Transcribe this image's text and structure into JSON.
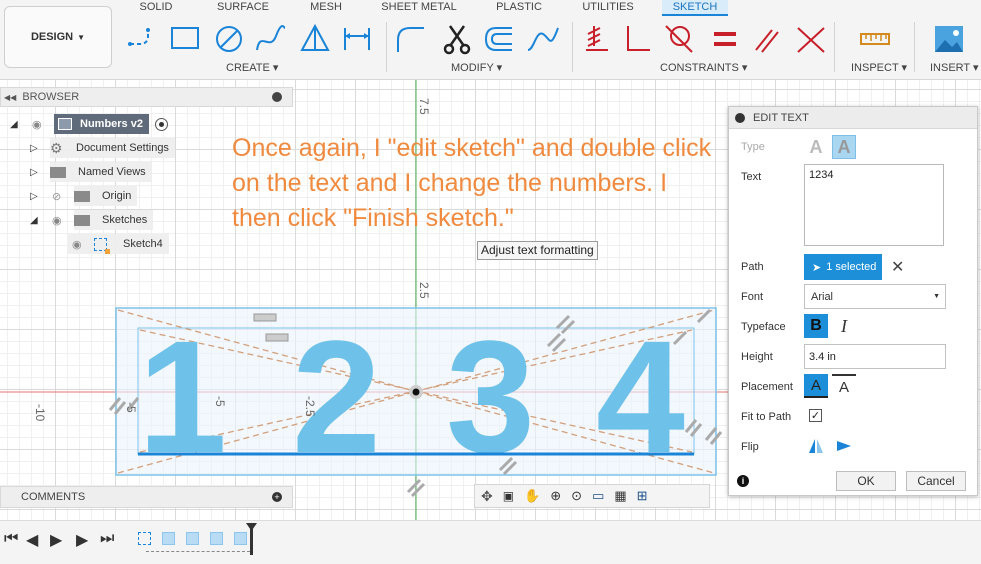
{
  "toolbar": {
    "design_label": "DESIGN",
    "tabs": [
      "SOLID",
      "SURFACE",
      "MESH",
      "SHEET METAL",
      "PLASTIC",
      "UTILITIES",
      "SKETCH"
    ],
    "active_tab": "SKETCH",
    "groups": [
      "CREATE",
      "MODIFY",
      "CONSTRAINTS",
      "INSPECT",
      "INSERT"
    ],
    "accent_color": "#1a84d8",
    "constraint_color": "#c8202a"
  },
  "browser": {
    "title": "BROWSER",
    "items": [
      "Numbers v2",
      "Document Settings",
      "Named Views",
      "Origin",
      "Sketches",
      "Sketch4"
    ]
  },
  "canvas": {
    "annotation": "Once again, I \"edit sketch\" and double click on the text and I change the numbers. I then click \"Finish sketch.\"",
    "tooltip": "Adjust text formatting",
    "sketch_text": "1 2 3 4",
    "dim_labels": [
      "7.5",
      "2.5",
      "-10",
      "-5",
      "-2.5",
      "-5"
    ],
    "text_color": "#6ec1e8"
  },
  "dialog": {
    "title": "EDIT TEXT",
    "type_label": "Type",
    "text_label": "Text",
    "text_value": "1234",
    "path_label": "Path",
    "path_value": "1 selected",
    "font_label": "Font",
    "font_value": "Arial",
    "typeface_label": "Typeface",
    "height_label": "Height",
    "height_value": "3.4 in",
    "placement_label": "Placement",
    "fit_label": "Fit to Path",
    "fit_checked": "✓",
    "flip_label": "Flip",
    "ok_label": "OK",
    "cancel_label": "Cancel",
    "info_icon": "i"
  },
  "comments": {
    "title": "COMMENTS"
  }
}
